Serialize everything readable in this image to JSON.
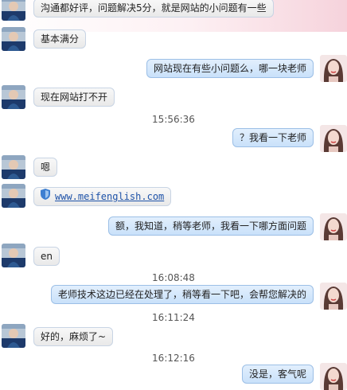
{
  "messages": [
    {
      "side": "left",
      "text": "沟通都好评，问题解决5分，就是网站的小问题有一些"
    },
    {
      "side": "left",
      "text": "基本满分"
    },
    {
      "side": "right",
      "text": "网站现在有些小问题么，哪一块老师"
    },
    {
      "side": "left",
      "text": "现在网站打不开"
    },
    {
      "side": "time",
      "text": "15:56:36"
    },
    {
      "side": "right",
      "text": "？我看一下老师"
    },
    {
      "side": "left",
      "text": "嗯"
    },
    {
      "side": "left",
      "text": "www.meifenglish.com"
    },
    {
      "side": "right",
      "text": "额，我知道，稍等老师，我看一下哪方面问题"
    },
    {
      "side": "left",
      "text": "en"
    },
    {
      "side": "time",
      "text": "16:08:48"
    },
    {
      "side": "right",
      "text": "老师技术这边已经在处理了，稍等看一下吧，会帮您解决的"
    },
    {
      "side": "time",
      "text": "16:11:24"
    },
    {
      "side": "left",
      "text": "好的，麻烦了~"
    },
    {
      "side": "time",
      "text": "16:12:16"
    },
    {
      "side": "right",
      "text": "没是，客气呢"
    }
  ]
}
